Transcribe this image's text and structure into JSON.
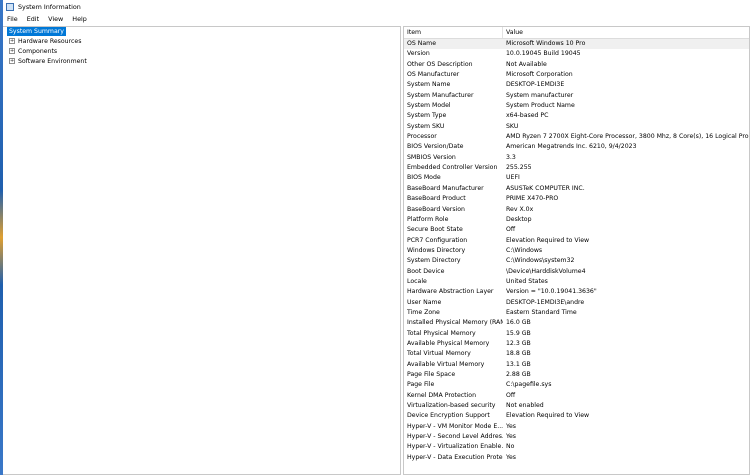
{
  "window": {
    "title": "System Information"
  },
  "menu": [
    "File",
    "Edit",
    "View",
    "Help"
  ],
  "tree": [
    {
      "label": "System Summary",
      "selected": true,
      "expandable": false
    },
    {
      "label": "Hardware Resources",
      "expandable": true
    },
    {
      "label": "Components",
      "expandable": true
    },
    {
      "label": "Software Environment",
      "expandable": true
    }
  ],
  "table": {
    "headers": {
      "item": "Item",
      "value": "Value"
    },
    "rows": [
      [
        "OS Name",
        "Microsoft Windows 10 Pro"
      ],
      [
        "Version",
        "10.0.19045 Build 19045"
      ],
      [
        "Other OS Description",
        "Not Available"
      ],
      [
        "OS Manufacturer",
        "Microsoft Corporation"
      ],
      [
        "System Name",
        "DESKTOP-1EMDI3E"
      ],
      [
        "System Manufacturer",
        "System manufacturer"
      ],
      [
        "System Model",
        "System Product Name"
      ],
      [
        "System Type",
        "x64-based PC"
      ],
      [
        "System SKU",
        "SKU"
      ],
      [
        "Processor",
        "AMD Ryzen 7 2700X Eight-Core Processor, 3800 Mhz, 8 Core(s), 16 Logical Pro"
      ],
      [
        "BIOS Version/Date",
        "American Megatrends Inc. 6210, 9/4/2023"
      ],
      [
        "SMBIOS Version",
        "3.3"
      ],
      [
        "Embedded Controller Version",
        "255.255"
      ],
      [
        "BIOS Mode",
        "UEFI"
      ],
      [
        "BaseBoard Manufacturer",
        "ASUSTeK COMPUTER INC."
      ],
      [
        "BaseBoard Product",
        "PRIME X470-PRO"
      ],
      [
        "BaseBoard Version",
        "Rev X.0x"
      ],
      [
        "Platform Role",
        "Desktop"
      ],
      [
        "Secure Boot State",
        "Off"
      ],
      [
        "PCR7 Configuration",
        "Elevation Required to View"
      ],
      [
        "Windows Directory",
        "C:\\Windows"
      ],
      [
        "System Directory",
        "C:\\Windows\\system32"
      ],
      [
        "Boot Device",
        "\\Device\\HarddiskVolume4"
      ],
      [
        "Locale",
        "United States"
      ],
      [
        "Hardware Abstraction Layer",
        "Version = \"10.0.19041.3636\""
      ],
      [
        "User Name",
        "DESKTOP-1EMDI3E\\andre"
      ],
      [
        "Time Zone",
        "Eastern Standard Time"
      ],
      [
        "Installed Physical Memory (RAM)",
        "16.0 GB"
      ],
      [
        "Total Physical Memory",
        "15.9 GB"
      ],
      [
        "Available Physical Memory",
        "12.3 GB"
      ],
      [
        "Total Virtual Memory",
        "18.8 GB"
      ],
      [
        "Available Virtual Memory",
        "13.1 GB"
      ],
      [
        "Page File Space",
        "2.88 GB"
      ],
      [
        "Page File",
        "C:\\pagefile.sys"
      ],
      [
        "Kernel DMA Protection",
        "Off"
      ],
      [
        "Virtualization-based security",
        "Not enabled"
      ],
      [
        "Device Encryption Support",
        "Elevation Required to View"
      ],
      [
        "Hyper-V - VM Monitor Mode E...",
        "Yes"
      ],
      [
        "Hyper-V - Second Level Addres...",
        "Yes"
      ],
      [
        "Hyper-V - Virtualization Enable...",
        "No"
      ],
      [
        "Hyper-V - Data Execution Prote...",
        "Yes"
      ]
    ]
  }
}
